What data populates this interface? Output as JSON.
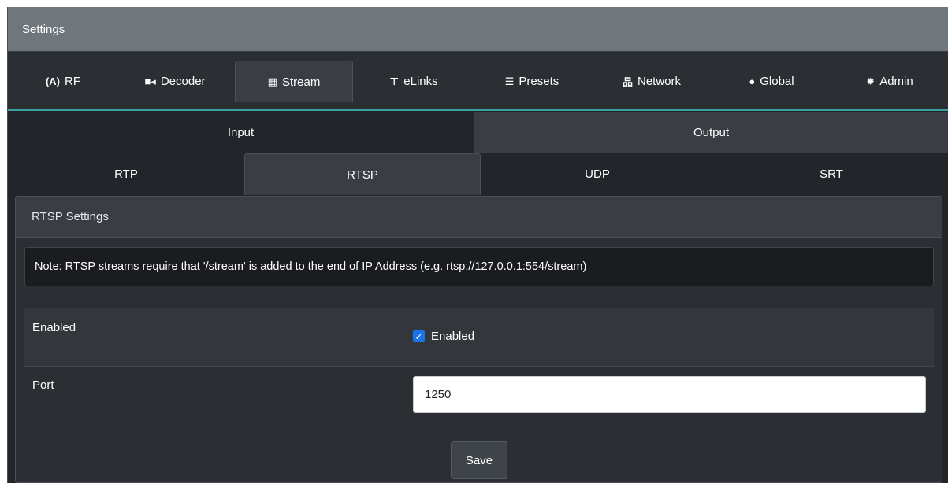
{
  "window": {
    "title": "Settings"
  },
  "main_tabs": [
    {
      "label": "RF",
      "icon": "antenna-icon",
      "glyph": "(A)"
    },
    {
      "label": "Decoder",
      "icon": "video-camera-icon",
      "glyph": "■◂"
    },
    {
      "label": "Stream",
      "icon": "film-icon",
      "glyph": "▦"
    },
    {
      "label": "eLinks",
      "icon": "network-links-icon",
      "glyph": "⊤"
    },
    {
      "label": "Presets",
      "icon": "list-icon",
      "glyph": "☰"
    },
    {
      "label": "Network",
      "icon": "sitemap-icon",
      "glyph": "品"
    },
    {
      "label": "Global",
      "icon": "globe-icon",
      "glyph": "●"
    },
    {
      "label": "Admin",
      "icon": "gear-icon",
      "glyph": "✹"
    }
  ],
  "main_tabs_active": "Stream",
  "direction_tabs": [
    {
      "label": "Input"
    },
    {
      "label": "Output"
    }
  ],
  "direction_active": "Output",
  "protocol_tabs": [
    {
      "label": "RTP"
    },
    {
      "label": "RTSP"
    },
    {
      "label": "UDP"
    },
    {
      "label": "SRT"
    }
  ],
  "protocol_active": "RTSP",
  "panel": {
    "title": "RTSP Settings",
    "note": "Note: RTSP streams require that '/stream' is added to the end of IP Address (e.g. rtsp://127.0.0.1:554/stream)",
    "enabled": {
      "label": "Enabled",
      "checkbox_label": "Enabled",
      "checked": true
    },
    "port": {
      "label": "Port",
      "value": "1250"
    },
    "save_label": "Save"
  },
  "colors": {
    "accent": "#3aa0a0",
    "checkbox": "#1a73e8",
    "titlebar": "#6f777c"
  }
}
